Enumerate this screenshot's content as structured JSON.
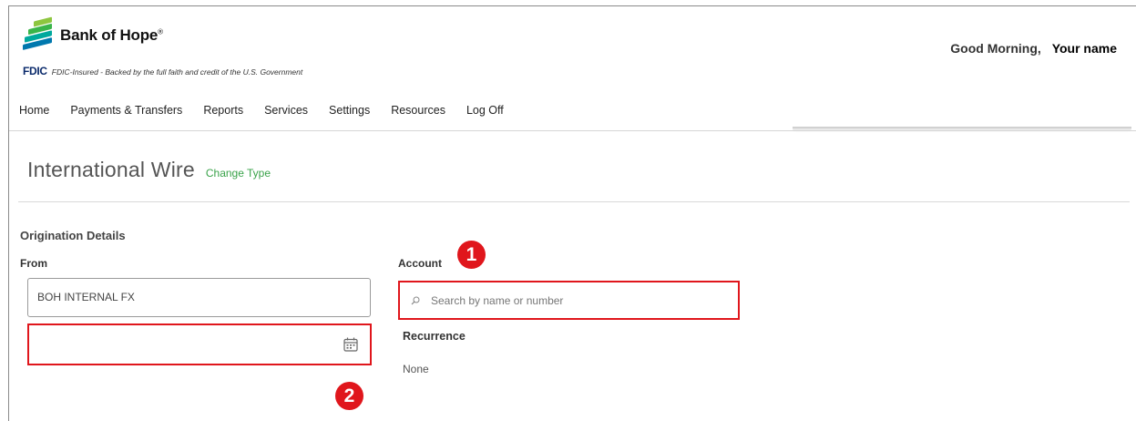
{
  "brand": {
    "name": "Bank of Hope",
    "trademark": "®",
    "fdic_mark": "FDIC",
    "fdic_text": "FDIC-Insured - Backed by the full faith and credit of the U.S. Government",
    "logo_colors": [
      "#8dc63f",
      "#3ab54a",
      "#00a99d",
      "#0078ae"
    ]
  },
  "header": {
    "greeting": "Good Morning,",
    "user_name": "Your name"
  },
  "nav": {
    "items": [
      {
        "label": "Home"
      },
      {
        "label": "Payments & Transfers"
      },
      {
        "label": "Reports"
      },
      {
        "label": "Services"
      },
      {
        "label": "Settings"
      },
      {
        "label": "Resources"
      },
      {
        "label": "Log Off"
      }
    ]
  },
  "page": {
    "title": "International Wire",
    "change_type_link": "Change Type"
  },
  "origination": {
    "section_title": "Origination Details",
    "from_label": "From",
    "from_value": "BOH INTERNAL FX",
    "date_value": ""
  },
  "account": {
    "label": "Account",
    "search_placeholder": "Search by name or number"
  },
  "recurrence": {
    "label": "Recurrence",
    "value": "None"
  },
  "callouts": {
    "marker_1": "1",
    "marker_2": "2",
    "highlight_color": "#e0161c"
  },
  "icons": {
    "search": "search-icon",
    "calendar": "calendar-icon"
  },
  "colors": {
    "accent_green": "#3aa34a",
    "text_dark": "#333333"
  }
}
